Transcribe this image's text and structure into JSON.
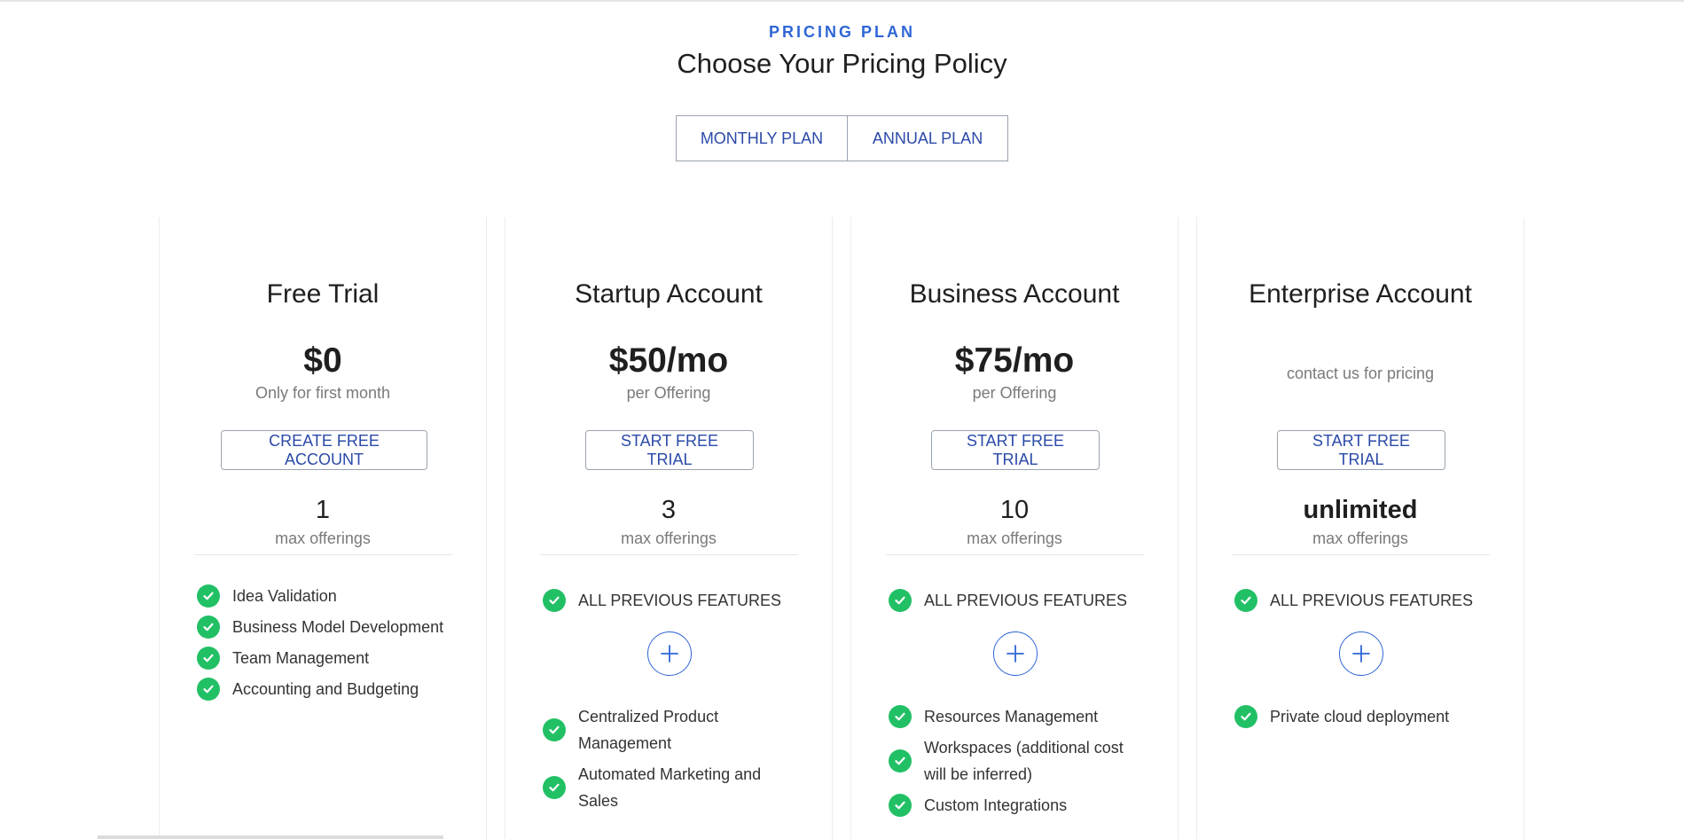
{
  "header": {
    "eyebrow": "PRICING PLAN",
    "title": "Choose Your Pricing Policy"
  },
  "toggle": {
    "monthly": "MONTHLY PLAN",
    "annual": "ANNUAL PLAN"
  },
  "plans": [
    {
      "name": "Free Trial",
      "price": "$0",
      "price_note": "Only for first month",
      "cta": "CREATE FREE ACCOUNT",
      "offerings": "1",
      "offerings_label": "max offerings",
      "features": [
        "Idea Validation",
        "Business Model Development",
        "Team Management",
        "Accounting and Budgeting"
      ]
    },
    {
      "name": "Startup Account",
      "price": "$50/mo",
      "price_note": "per Offering",
      "cta": "START FREE TRIAL",
      "offerings": "3",
      "offerings_label": "max offerings",
      "previous": "ALL PREVIOUS FEATURES",
      "features": [
        "Centralized Product Management",
        "Automated Marketing and Sales"
      ]
    },
    {
      "name": "Business Account",
      "price": "$75/mo",
      "price_note": "per Offering",
      "cta": "START FREE TRIAL",
      "offerings": "10",
      "offerings_label": "max offerings",
      "previous": "ALL PREVIOUS FEATURES",
      "features": [
        "Resources Management",
        "Workspaces (additional cost will be inferred)",
        "Custom Integrations"
      ]
    },
    {
      "name": "Enterprise Account",
      "price_note": "contact us for pricing",
      "cta": "START FREE TRIAL",
      "offerings": "unlimited",
      "offerings_label": "max offerings",
      "previous": "ALL PREVIOUS FEATURES",
      "features": [
        "Private cloud deployment"
      ]
    }
  ],
  "colors": {
    "accent": "#2f66d6",
    "button_text": "#2b4aa8",
    "check": "#22c065"
  },
  "icons": {
    "check": "check-circle-icon",
    "plus": "plus-circle-icon"
  }
}
